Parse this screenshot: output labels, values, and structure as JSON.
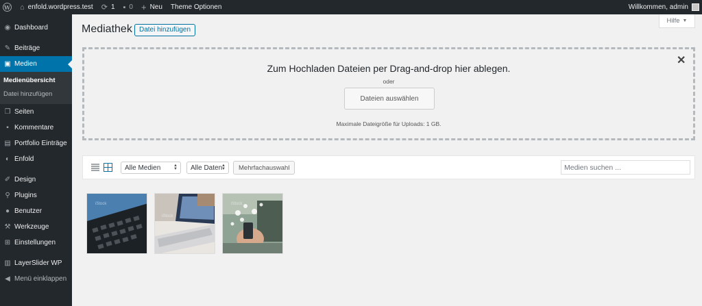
{
  "adminbar": {
    "site_name": "enfold.wordpress.test",
    "updates_count": "1",
    "comments_count": "0",
    "new_label": "Neu",
    "theme_options_label": "Theme Optionen",
    "welcome_text": "Willkommen, admin"
  },
  "sidebar": {
    "items": [
      {
        "label": "Dashboard",
        "icon": "dashboard-icon"
      },
      {
        "label": "Beiträge",
        "icon": "pin-icon"
      },
      {
        "label": "Medien",
        "icon": "media-icon"
      },
      {
        "label": "Seiten",
        "icon": "pages-icon"
      },
      {
        "label": "Kommentare",
        "icon": "comment-icon"
      },
      {
        "label": "Portfolio Einträge",
        "icon": "portfolio-icon"
      },
      {
        "label": "Enfold",
        "icon": "theme-icon"
      },
      {
        "label": "Design",
        "icon": "brush-icon"
      },
      {
        "label": "Plugins",
        "icon": "plugin-icon"
      },
      {
        "label": "Benutzer",
        "icon": "user-icon"
      },
      {
        "label": "Werkzeuge",
        "icon": "wrench-icon"
      },
      {
        "label": "Einstellungen",
        "icon": "settings-icon"
      },
      {
        "label": "LayerSlider WP",
        "icon": "layers-icon"
      },
      {
        "label": "Menü einklappen",
        "icon": "collapse-icon"
      }
    ],
    "submenu": [
      {
        "label": "Medienübersicht"
      },
      {
        "label": "Datei hinzufügen"
      }
    ]
  },
  "main": {
    "title": "Mediathek",
    "add_button": "Datei hinzufügen",
    "help_label": "Hilfe",
    "uploader": {
      "instructions": "Zum Hochladen Dateien per Drag-and-drop hier ablegen.",
      "or_text": "oder",
      "select_button": "Dateien auswählen",
      "max_size": "Maximale Dateigröße für Uploads: 1 GB."
    },
    "toolbar": {
      "filter_type": "Alle Medien",
      "filter_date": "Alle Daten",
      "bulk_select": "Mehrfachauswahl",
      "search_placeholder": "Medien suchen ..."
    },
    "watermark": "iStock"
  }
}
